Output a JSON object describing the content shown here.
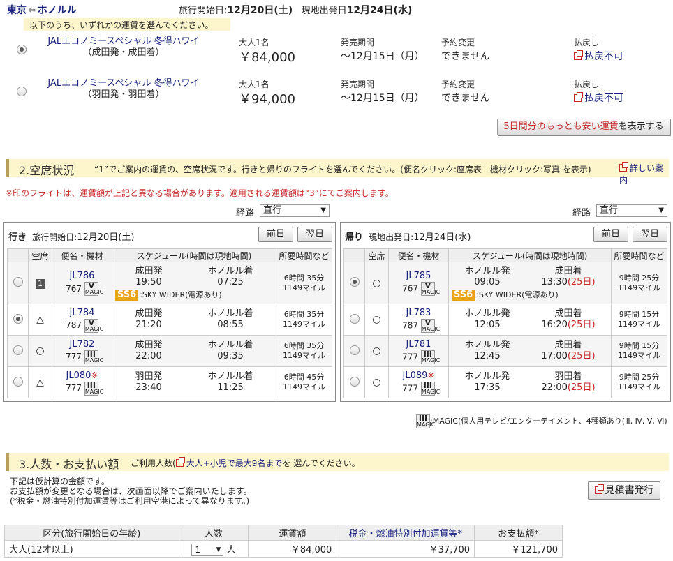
{
  "header": {
    "origin": "東京",
    "arrow": "⇔",
    "destination": "ホノルル",
    "start_label": "旅行開始日:",
    "start_date": "12月20日(土)",
    "local_label": "現地出発日",
    "local_date": "12月24日(水)",
    "notice": "以下のうち、いずれかの運賃を選んでください。"
  },
  "fares": [
    {
      "name": "JALエコノミースペシャル 冬得ハワイ",
      "sub": "（成田発・成田着）",
      "adult_label": "大人1名",
      "price": "￥84,000",
      "sale_label": "発売期間",
      "sale": "～12月15日（月）",
      "change_label": "予約変更",
      "change": "できません",
      "refund_label": "払戻し",
      "refund": "払戻不可",
      "selected": true
    },
    {
      "name": "JALエコノミースペシャル 冬得ハワイ",
      "sub": "（羽田発・羽田着）",
      "adult_label": "大人1名",
      "price": "￥94,000",
      "sale_label": "発売期間",
      "sale": "～12月15日（月）",
      "change_label": "予約変更",
      "change": "できません",
      "refund_label": "払戻し",
      "refund": "払戻不可",
      "selected": false
    }
  ],
  "cheap_button": {
    "highlight": "5日間分のもっとも安い運賃",
    "rest": "を表示する"
  },
  "section2": {
    "title": "2.空席状況",
    "desc": "“1”でご案内の運賃の、空席状況です。行きと帰りのフライトを選んでください。(便名クリック:座席表　機材クリック:写真 を表示)",
    "detail_link": "詳しい案内",
    "warning": "※印のフライトは、運賃額が上記と異なる場合があります。適用される運賃額は“3”にてご案内します。"
  },
  "route_select": {
    "label": "経路",
    "value": "直行"
  },
  "columns": {
    "seat": "空席",
    "flight": "便名・機材",
    "schedule": "スケジュール(時間は現地時間)",
    "duration": "所要時間など"
  },
  "prev_label": "前日",
  "next_label": "翌日",
  "outbound": {
    "label": "行き",
    "date_label": "旅行開始日:",
    "date": "12月20日(土)",
    "flights": [
      {
        "no": "JL786",
        "star": "",
        "type": "767",
        "magic": "V",
        "dep": "成田発",
        "dep_time": "19:50",
        "arr": "ホノルル着",
        "arr_time": "07:25",
        "arr_note": "",
        "dur": "6時間 35分",
        "miles": "1149マイル",
        "seat": "1",
        "ss6": "SS6",
        "ss6_text": ":SKY WIDER(電源あり)",
        "selected": false
      },
      {
        "no": "JL784",
        "star": "",
        "type": "787",
        "magic": "V",
        "dep": "成田発",
        "dep_time": "21:20",
        "arr": "ホノルル着",
        "arr_time": "08:55",
        "arr_note": "",
        "dur": "6時間 35分",
        "miles": "1149マイル",
        "seat": "△",
        "selected": true
      },
      {
        "no": "JL782",
        "star": "",
        "type": "777",
        "magic": "III",
        "dep": "成田発",
        "dep_time": "22:00",
        "arr": "ホノルル着",
        "arr_time": "09:35",
        "arr_note": "",
        "dur": "6時間 35分",
        "miles": "1149マイル",
        "seat": "○",
        "selected": false
      },
      {
        "no": "JL080",
        "star": "※",
        "type": "777",
        "magic": "III",
        "dep": "羽田発",
        "dep_time": "23:40",
        "arr": "ホノルル着",
        "arr_time": "11:25",
        "arr_note": "",
        "dur": "6時間 45分",
        "miles": "1149マイル",
        "seat": "△",
        "selected": false
      }
    ]
  },
  "return": {
    "label": "帰り",
    "date_label": "現地出発日:",
    "date": "12月24日(水)",
    "flights": [
      {
        "no": "JL785",
        "star": "",
        "type": "767",
        "magic": "V",
        "dep": "ホノルル発",
        "dep_time": "09:05",
        "arr": "成田着",
        "arr_time": "13:30",
        "arr_note": "(25日)",
        "dur": "9時間 25分",
        "miles": "1149マイル",
        "seat": "○",
        "ss6": "SS6",
        "ss6_text": ":SKY WIDER(電源あり)",
        "selected": true
      },
      {
        "no": "JL783",
        "star": "",
        "type": "787",
        "magic": "V",
        "dep": "ホノルル発",
        "dep_time": "12:05",
        "arr": "成田着",
        "arr_time": "16:20",
        "arr_note": "(25日)",
        "dur": "9時間 15分",
        "miles": "1149マイル",
        "seat": "○",
        "selected": false
      },
      {
        "no": "JL781",
        "star": "",
        "type": "777",
        "magic": "III",
        "dep": "ホノルル発",
        "dep_time": "12:45",
        "arr": "成田着",
        "arr_time": "17:00",
        "arr_note": "(25日)",
        "dur": "9時間 15分",
        "miles": "1149マイル",
        "seat": "○",
        "selected": false
      },
      {
        "no": "JL089",
        "star": "※",
        "type": "777",
        "magic": "III",
        "dep": "ホノルル発",
        "dep_time": "17:35",
        "arr": "羽田着",
        "arr_time": "22:00",
        "arr_note": "(25日)",
        "dur": "9時間 25分",
        "miles": "1149マイル",
        "seat": "○",
        "selected": false
      }
    ]
  },
  "magic_note": ":MAGIC(個人用テレビ/エンターテイメント、4種類あり(Ⅲ, Ⅳ, Ⅴ, Ⅵ)",
  "section3": {
    "title": "3.人数・お支払い額",
    "desc_pre": "ご利用人数(",
    "desc_link": "大人+小児で最大9名まで",
    "desc_post": "を 選んでください。",
    "note1": "下記は仮計算の金額です。",
    "note2": "お支払額が変更となる場合は、次画面以降でご案内いたします。",
    "note3": "(*税金・燃油特別付加運賃等はご利用空港によって異なります。)",
    "quote_button": "見積書発行"
  },
  "price_table": {
    "headers": [
      "区分(旅行開始日の年齢)",
      "人数",
      "運賃額",
      "税金・燃油特別付加運賃等*",
      "お支払額*"
    ],
    "rows": [
      {
        "category": "大人(12才以上)",
        "count": "1",
        "unit": "人",
        "fare": "￥84,000",
        "tax": "￥37,700",
        "total": "￥121,700"
      }
    ]
  }
}
